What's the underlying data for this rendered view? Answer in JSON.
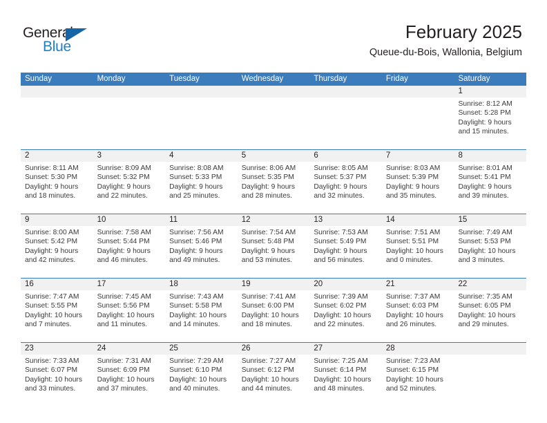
{
  "brand": {
    "name_part1": "General",
    "name_part2": "Blue",
    "color_dark": "#231f20",
    "color_blue": "#1f7fc4",
    "triangle_color": "#1565a8"
  },
  "header": {
    "month_title": "February 2025",
    "location": "Queue-du-Bois, Wallonia, Belgium"
  },
  "theme": {
    "header_bar": "#3b7cbd",
    "day_band": "#f1f1f1",
    "row_divider": "#3b7cbd",
    "text": "#231f20",
    "body_text": "#3a3a3a"
  },
  "weekdays": [
    "Sunday",
    "Monday",
    "Tuesday",
    "Wednesday",
    "Thursday",
    "Friday",
    "Saturday"
  ],
  "weeks": [
    [
      {
        "day": "",
        "empty": true,
        "sunrise": "",
        "sunset": "",
        "daylight_line1": "",
        "daylight_line2": ""
      },
      {
        "day": "",
        "empty": true,
        "sunrise": "",
        "sunset": "",
        "daylight_line1": "",
        "daylight_line2": ""
      },
      {
        "day": "",
        "empty": true,
        "sunrise": "",
        "sunset": "",
        "daylight_line1": "",
        "daylight_line2": ""
      },
      {
        "day": "",
        "empty": true,
        "sunrise": "",
        "sunset": "",
        "daylight_line1": "",
        "daylight_line2": ""
      },
      {
        "day": "",
        "empty": true,
        "sunrise": "",
        "sunset": "",
        "daylight_line1": "",
        "daylight_line2": ""
      },
      {
        "day": "",
        "empty": true,
        "sunrise": "",
        "sunset": "",
        "daylight_line1": "",
        "daylight_line2": ""
      },
      {
        "day": "1",
        "empty": false,
        "sunrise": "Sunrise: 8:12 AM",
        "sunset": "Sunset: 5:28 PM",
        "daylight_line1": "Daylight: 9 hours",
        "daylight_line2": "and 15 minutes."
      }
    ],
    [
      {
        "day": "2",
        "empty": false,
        "sunrise": "Sunrise: 8:11 AM",
        "sunset": "Sunset: 5:30 PM",
        "daylight_line1": "Daylight: 9 hours",
        "daylight_line2": "and 18 minutes."
      },
      {
        "day": "3",
        "empty": false,
        "sunrise": "Sunrise: 8:09 AM",
        "sunset": "Sunset: 5:32 PM",
        "daylight_line1": "Daylight: 9 hours",
        "daylight_line2": "and 22 minutes."
      },
      {
        "day": "4",
        "empty": false,
        "sunrise": "Sunrise: 8:08 AM",
        "sunset": "Sunset: 5:33 PM",
        "daylight_line1": "Daylight: 9 hours",
        "daylight_line2": "and 25 minutes."
      },
      {
        "day": "5",
        "empty": false,
        "sunrise": "Sunrise: 8:06 AM",
        "sunset": "Sunset: 5:35 PM",
        "daylight_line1": "Daylight: 9 hours",
        "daylight_line2": "and 28 minutes."
      },
      {
        "day": "6",
        "empty": false,
        "sunrise": "Sunrise: 8:05 AM",
        "sunset": "Sunset: 5:37 PM",
        "daylight_line1": "Daylight: 9 hours",
        "daylight_line2": "and 32 minutes."
      },
      {
        "day": "7",
        "empty": false,
        "sunrise": "Sunrise: 8:03 AM",
        "sunset": "Sunset: 5:39 PM",
        "daylight_line1": "Daylight: 9 hours",
        "daylight_line2": "and 35 minutes."
      },
      {
        "day": "8",
        "empty": false,
        "sunrise": "Sunrise: 8:01 AM",
        "sunset": "Sunset: 5:41 PM",
        "daylight_line1": "Daylight: 9 hours",
        "daylight_line2": "and 39 minutes."
      }
    ],
    [
      {
        "day": "9",
        "empty": false,
        "sunrise": "Sunrise: 8:00 AM",
        "sunset": "Sunset: 5:42 PM",
        "daylight_line1": "Daylight: 9 hours",
        "daylight_line2": "and 42 minutes."
      },
      {
        "day": "10",
        "empty": false,
        "sunrise": "Sunrise: 7:58 AM",
        "sunset": "Sunset: 5:44 PM",
        "daylight_line1": "Daylight: 9 hours",
        "daylight_line2": "and 46 minutes."
      },
      {
        "day": "11",
        "empty": false,
        "sunrise": "Sunrise: 7:56 AM",
        "sunset": "Sunset: 5:46 PM",
        "daylight_line1": "Daylight: 9 hours",
        "daylight_line2": "and 49 minutes."
      },
      {
        "day": "12",
        "empty": false,
        "sunrise": "Sunrise: 7:54 AM",
        "sunset": "Sunset: 5:48 PM",
        "daylight_line1": "Daylight: 9 hours",
        "daylight_line2": "and 53 minutes."
      },
      {
        "day": "13",
        "empty": false,
        "sunrise": "Sunrise: 7:53 AM",
        "sunset": "Sunset: 5:49 PM",
        "daylight_line1": "Daylight: 9 hours",
        "daylight_line2": "and 56 minutes."
      },
      {
        "day": "14",
        "empty": false,
        "sunrise": "Sunrise: 7:51 AM",
        "sunset": "Sunset: 5:51 PM",
        "daylight_line1": "Daylight: 10 hours",
        "daylight_line2": "and 0 minutes."
      },
      {
        "day": "15",
        "empty": false,
        "sunrise": "Sunrise: 7:49 AM",
        "sunset": "Sunset: 5:53 PM",
        "daylight_line1": "Daylight: 10 hours",
        "daylight_line2": "and 3 minutes."
      }
    ],
    [
      {
        "day": "16",
        "empty": false,
        "sunrise": "Sunrise: 7:47 AM",
        "sunset": "Sunset: 5:55 PM",
        "daylight_line1": "Daylight: 10 hours",
        "daylight_line2": "and 7 minutes."
      },
      {
        "day": "17",
        "empty": false,
        "sunrise": "Sunrise: 7:45 AM",
        "sunset": "Sunset: 5:56 PM",
        "daylight_line1": "Daylight: 10 hours",
        "daylight_line2": "and 11 minutes."
      },
      {
        "day": "18",
        "empty": false,
        "sunrise": "Sunrise: 7:43 AM",
        "sunset": "Sunset: 5:58 PM",
        "daylight_line1": "Daylight: 10 hours",
        "daylight_line2": "and 14 minutes."
      },
      {
        "day": "19",
        "empty": false,
        "sunrise": "Sunrise: 7:41 AM",
        "sunset": "Sunset: 6:00 PM",
        "daylight_line1": "Daylight: 10 hours",
        "daylight_line2": "and 18 minutes."
      },
      {
        "day": "20",
        "empty": false,
        "sunrise": "Sunrise: 7:39 AM",
        "sunset": "Sunset: 6:02 PM",
        "daylight_line1": "Daylight: 10 hours",
        "daylight_line2": "and 22 minutes."
      },
      {
        "day": "21",
        "empty": false,
        "sunrise": "Sunrise: 7:37 AM",
        "sunset": "Sunset: 6:03 PM",
        "daylight_line1": "Daylight: 10 hours",
        "daylight_line2": "and 26 minutes."
      },
      {
        "day": "22",
        "empty": false,
        "sunrise": "Sunrise: 7:35 AM",
        "sunset": "Sunset: 6:05 PM",
        "daylight_line1": "Daylight: 10 hours",
        "daylight_line2": "and 29 minutes."
      }
    ],
    [
      {
        "day": "23",
        "empty": false,
        "sunrise": "Sunrise: 7:33 AM",
        "sunset": "Sunset: 6:07 PM",
        "daylight_line1": "Daylight: 10 hours",
        "daylight_line2": "and 33 minutes."
      },
      {
        "day": "24",
        "empty": false,
        "sunrise": "Sunrise: 7:31 AM",
        "sunset": "Sunset: 6:09 PM",
        "daylight_line1": "Daylight: 10 hours",
        "daylight_line2": "and 37 minutes."
      },
      {
        "day": "25",
        "empty": false,
        "sunrise": "Sunrise: 7:29 AM",
        "sunset": "Sunset: 6:10 PM",
        "daylight_line1": "Daylight: 10 hours",
        "daylight_line2": "and 40 minutes."
      },
      {
        "day": "26",
        "empty": false,
        "sunrise": "Sunrise: 7:27 AM",
        "sunset": "Sunset: 6:12 PM",
        "daylight_line1": "Daylight: 10 hours",
        "daylight_line2": "and 44 minutes."
      },
      {
        "day": "27",
        "empty": false,
        "sunrise": "Sunrise: 7:25 AM",
        "sunset": "Sunset: 6:14 PM",
        "daylight_line1": "Daylight: 10 hours",
        "daylight_line2": "and 48 minutes."
      },
      {
        "day": "28",
        "empty": false,
        "sunrise": "Sunrise: 7:23 AM",
        "sunset": "Sunset: 6:15 PM",
        "daylight_line1": "Daylight: 10 hours",
        "daylight_line2": "and 52 minutes."
      },
      {
        "day": "",
        "empty": true,
        "sunrise": "",
        "sunset": "",
        "daylight_line1": "",
        "daylight_line2": ""
      }
    ]
  ]
}
